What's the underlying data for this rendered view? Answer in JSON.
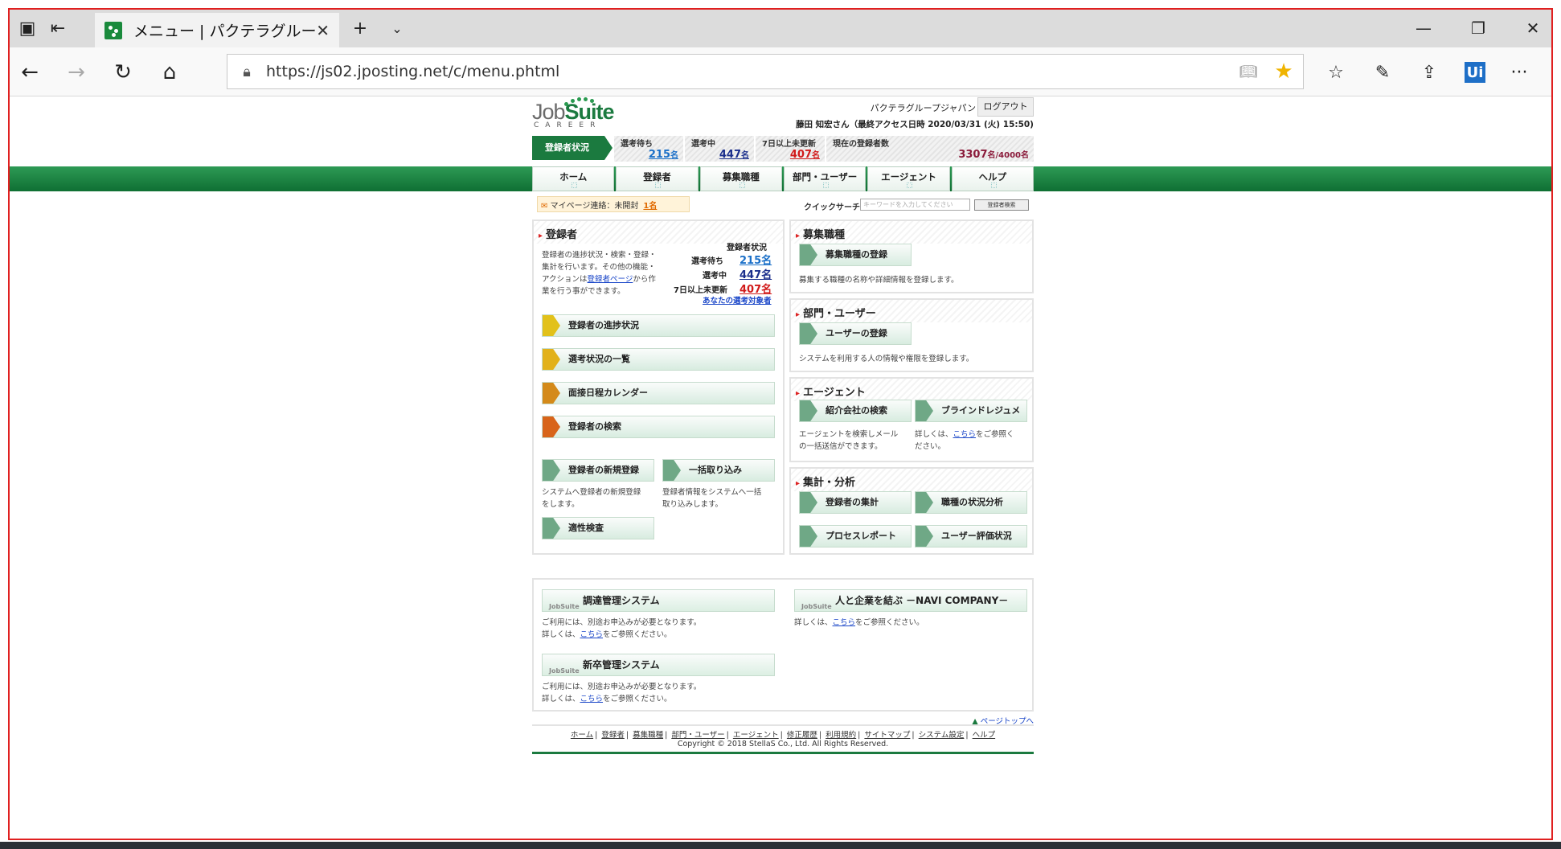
{
  "browser": {
    "tab_title": "メニュー | パクテラグループジ",
    "url": "https://js02.jposting.net/c/menu.phtml"
  },
  "header": {
    "logo_text_a": "Job",
    "logo_text_b": "Suite",
    "logo_sub": "CAREER",
    "company": "パクテラグループジャパン",
    "logout": "ログアウト",
    "user_info": "藤田 知宏さん（最終アクセス日時 2020/03/31 (火) 15:50)",
    "status_label": "登録者状況",
    "stats": [
      {
        "label": "選考待ち",
        "value": "215",
        "unit": "名",
        "color": "#1a6fc8"
      },
      {
        "label": "選考中",
        "value": "447",
        "unit": "名",
        "color": "#1a2e8c"
      },
      {
        "label": "7日以上未更新",
        "value": "407",
        "unit": "名",
        "color": "#d11a1a"
      },
      {
        "label": "現在の登録者数",
        "value": "3307",
        "unit": "名/4000名",
        "color": "#8a1a3a"
      }
    ]
  },
  "menu": [
    "ホーム",
    "登録者",
    "募集職種",
    "部門・ユーザー",
    "エージェント",
    "ヘルプ"
  ],
  "notice": {
    "text": "マイページ連絡：未開封",
    "count": "1名"
  },
  "quick_search": {
    "label": "クイックサーチ",
    "placeholder": "キーワードを入力してください",
    "button": "登録者検索"
  },
  "registrants": {
    "title": "登録者",
    "desc_a": "登録者の進捗状況・検索・登録・",
    "desc_b": "集計を行います。その他の機能・",
    "desc_c": "アクションは",
    "desc_link": "登録者ページ",
    "desc_d": "から作",
    "desc_e": "業を行う事ができます。",
    "status_title": "登録者状況",
    "s1_label": "選考待ち",
    "s1_value": "215名",
    "s2_label": "選考中",
    "s2_value": "447名",
    "s3_label": "7日以上未更新",
    "s3_value": "407名",
    "my_targets": "あなたの選考対象者",
    "btn_progress": "登録者の進捗状況",
    "btn_list": "選考状況の一覧",
    "btn_calendar": "面接日程カレンダー",
    "btn_search": "登録者の検索",
    "btn_new": "登録者の新規登録",
    "btn_bulk": "一括取り込み",
    "new_desc_a": "システムへ登録者の新規登録",
    "new_desc_b": "をします。",
    "bulk_desc_a": "登録者情報をシステムへ一括",
    "bulk_desc_b": "取り込みします。",
    "btn_aptitude": "適性検査"
  },
  "jobs": {
    "title": "募集職種",
    "btn": "募集職種の登録",
    "desc": "募集する職種の名称や詳細情報を登録します。"
  },
  "dept": {
    "title": "部門・ユーザー",
    "btn": "ユーザーの登録",
    "desc": "システムを利用する人の情報や権限を登録します。"
  },
  "agent": {
    "title": "エージェント",
    "btn_search": "紹介会社の検索",
    "btn_blind": "ブラインドレジュメ",
    "desc_a": "エージェントを検索しメール",
    "desc_b": "の一括送信ができます。",
    "ref_a": "詳しくは、",
    "ref_link": "こちら",
    "ref_b": "をご参照く",
    "ref_c": "ださい。"
  },
  "analysis": {
    "title": "集計・分析",
    "btn_reg": "登録者の集計",
    "btn_job": "職種の状況分析",
    "btn_process": "プロセスレポート",
    "btn_user": "ユーザー評価状況"
  },
  "extras": {
    "procure": "調達管理システム",
    "navi": "人と企業を結ぶ －NAVI COMPANY－",
    "newgrad": "新卒管理システム",
    "mini_logo": "JobSuite",
    "note_a": "ご利用には、別途お申込みが必要となります。",
    "note_b": "詳しくは、",
    "note_link": "こちら",
    "note_c": "をご参照ください。"
  },
  "footer": {
    "page_top": "ページトップへ",
    "links": [
      "ホーム",
      "登録者",
      "募集職種",
      "部門・ユーザー",
      "エージェント",
      "修正履歴",
      "利用規約",
      "サイトマップ",
      "システム設定",
      "ヘルプ"
    ],
    "copyright": "Copyright © 2018 StellaS Co., Ltd. All Rights Reserved."
  }
}
